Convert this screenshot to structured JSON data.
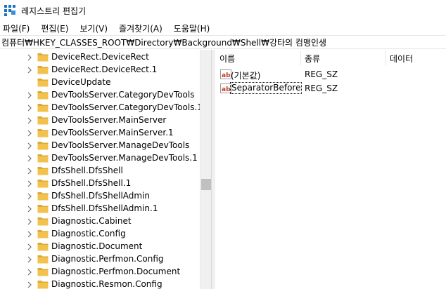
{
  "window": {
    "title": "레지스트리 편집기",
    "icon": "regedit-icon"
  },
  "menu": [
    "파일(F)",
    "편집(E)",
    "보기(V)",
    "즐겨찾기(A)",
    "도움말(H)"
  ],
  "address": "컴퓨터₩HKEY_CLASSES_ROOT₩Directory₩Background₩Shell₩강타의 컴맹인생",
  "tree": {
    "items": [
      "DeviceRect.DeviceRect",
      "DeviceRect.DeviceRect.1",
      "DeviceUpdate",
      "DevToolsServer.CategoryDevTools",
      "DevToolsServer.CategoryDevTools.1",
      "DevToolsServer.MainServer",
      "DevToolsServer.MainServer.1",
      "DevToolsServer.ManageDevTools",
      "DevToolsServer.ManageDevTools.1",
      "DfsShell.DfsShell",
      "DfsShell.DfsShell.1",
      "DfsShell.DfsShellAdmin",
      "DfsShell.DfsShellAdmin.1",
      "Diagnostic.Cabinet",
      "Diagnostic.Config",
      "Diagnostic.Document",
      "Diagnostic.Perfmon.Config",
      "Diagnostic.Perfmon.Document",
      "Diagnostic.Resmon.Config"
    ],
    "has_chevron": [
      true,
      true,
      false,
      true,
      true,
      true,
      true,
      true,
      true,
      true,
      true,
      true,
      true,
      true,
      true,
      true,
      true,
      true,
      true
    ]
  },
  "list": {
    "columns": [
      "이름",
      "종류",
      "데이터"
    ],
    "rows": [
      {
        "name": "(기본값)",
        "type": "REG_SZ",
        "data": ""
      },
      {
        "name": "SeparatorBefore",
        "type": "REG_SZ",
        "data": ""
      }
    ]
  },
  "colors": {
    "folder": "#f3c24d",
    "folder_dark": "#dca935",
    "icon_red": "#c0392b",
    "scroll_thumb": "#c0c0c0"
  }
}
